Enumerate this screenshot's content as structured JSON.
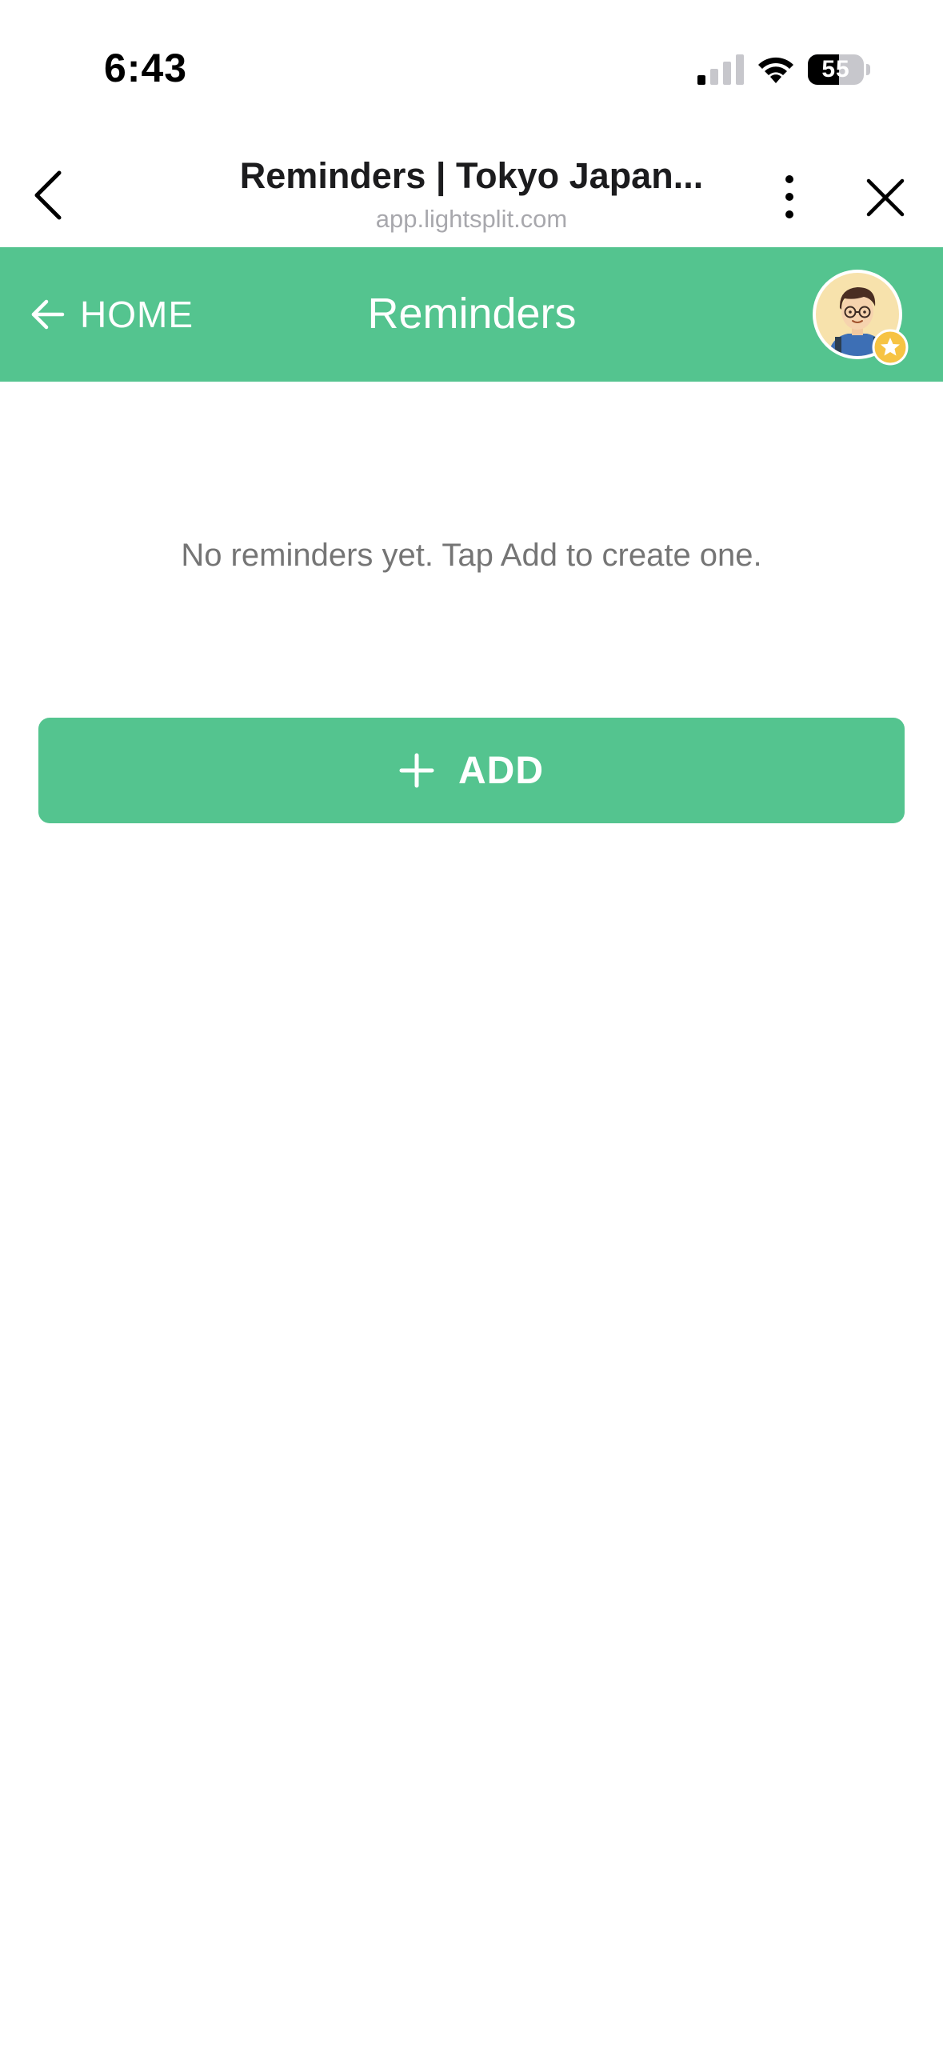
{
  "status_bar": {
    "time": "6:43",
    "battery_percent": "55",
    "battery_level": 0.55
  },
  "browser": {
    "title": "Reminders | Tokyo Japan...",
    "url": "app.lightsplit.com"
  },
  "app_bar": {
    "home_label": "HOME",
    "title": "Reminders"
  },
  "content": {
    "empty_message": "No reminders yet. Tap Add to create one.",
    "add_button_label": "ADD"
  },
  "colors": {
    "brand_green": "#54c48f",
    "badge_yellow": "#f6c343"
  },
  "icons": {
    "browser_back": "chevron-left-icon",
    "browser_more": "more-vertical-icon",
    "browser_close": "close-icon",
    "home_back": "arrow-left-icon",
    "add": "plus-icon",
    "badge": "star-badge-icon"
  }
}
